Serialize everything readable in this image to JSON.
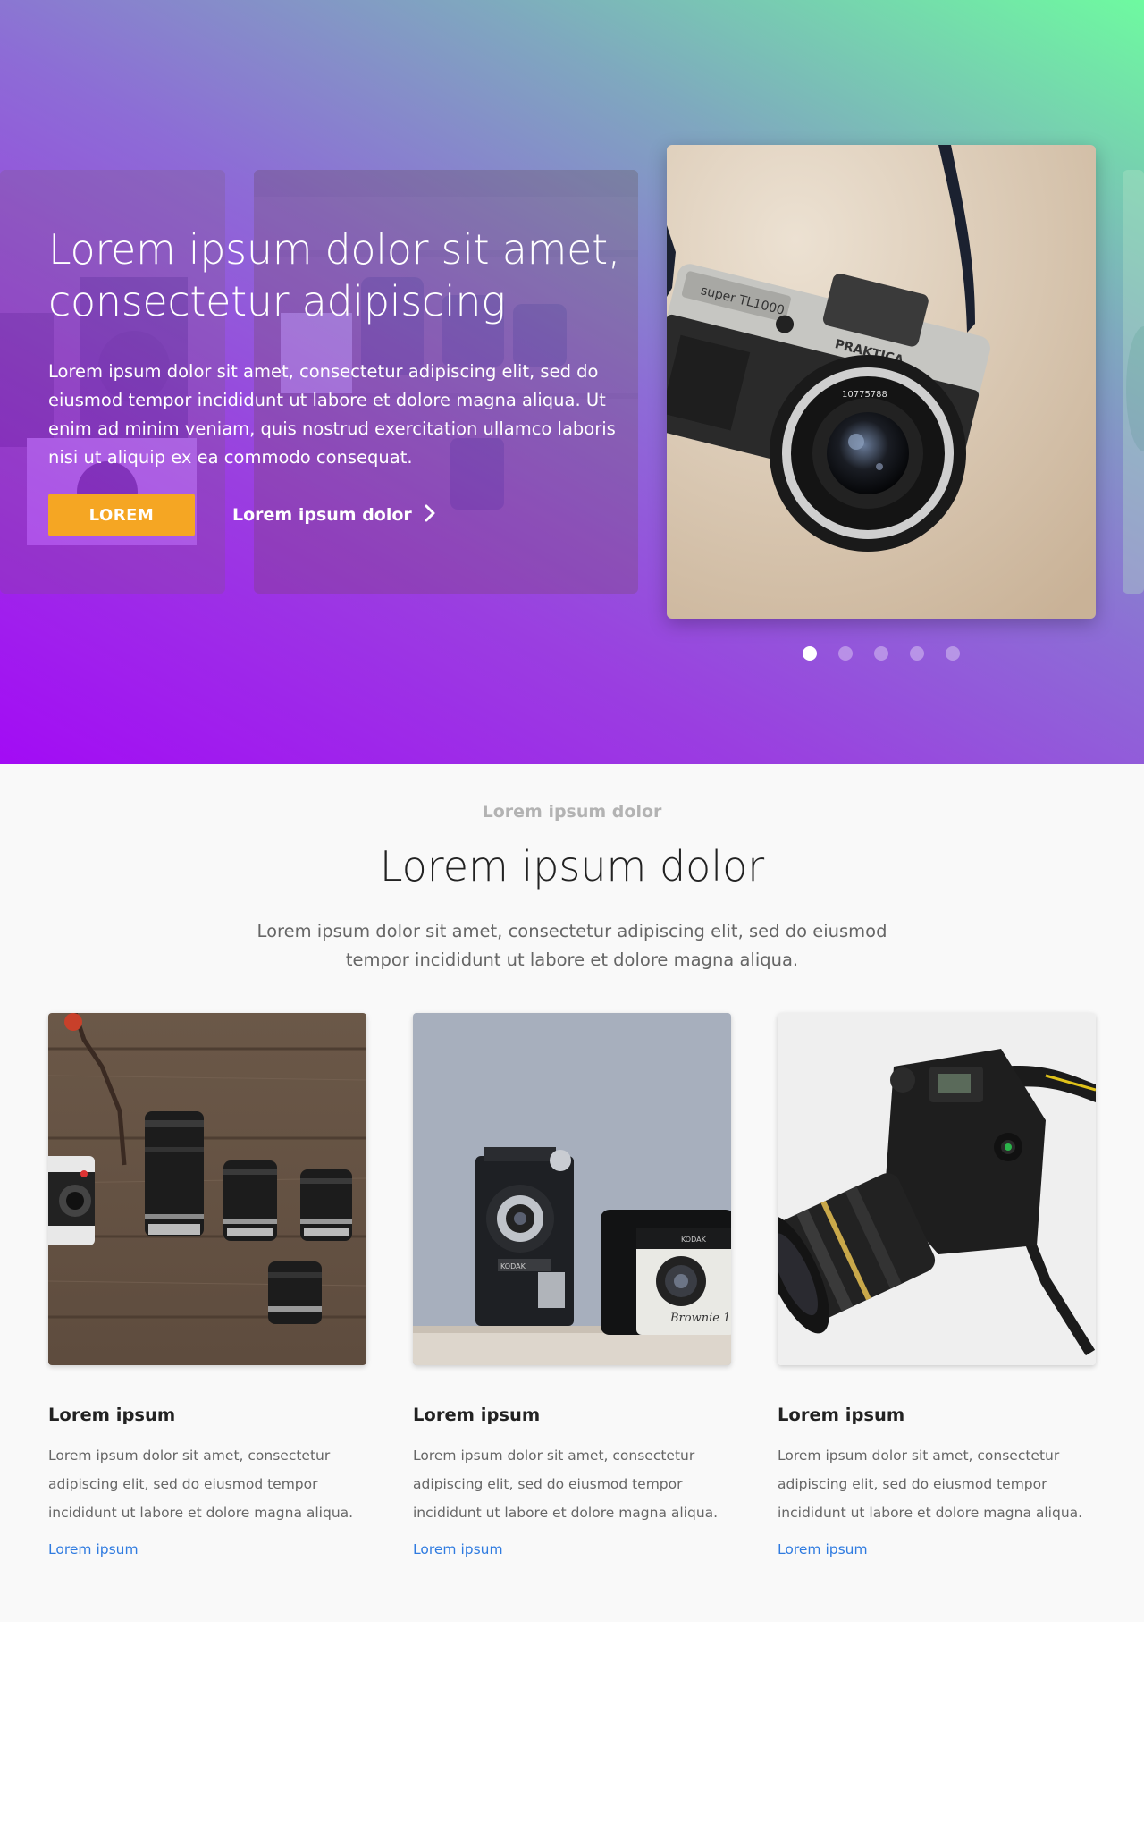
{
  "hero": {
    "title_line1": "Lorem ipsum dolor sit amet,",
    "title_line2": "consectetur adipiscing",
    "body": "Lorem ipsum dolor sit amet, consectetur adipiscing elit, sed do eiusmod tempor incididunt ut labore et dolore magna aliqua. Ut enim ad minim veniam, quis nostrud exercitation ullamco laboris nisi ut aliquip ex ea commodo consequat.",
    "primary_button": "LOREM",
    "secondary_link": "Lorem ipsum dolor",
    "photo_icon": "camera-photo",
    "carousel": {
      "total_slides": 5,
      "active_index": 0
    }
  },
  "features": {
    "eyebrow": "Lorem ipsum dolor",
    "title": "Lorem ipsum dolor",
    "description": "Lorem ipsum dolor sit amet, consectetur adipiscing elit, sed do eiusmod tempor incididunt ut labore et dolore magna aliqua.",
    "cards": [
      {
        "image": "lenses-on-wood-photo",
        "title": "Lorem ipsum",
        "body": "Lorem ipsum dolor sit amet, consectetur adipiscing elit, sed do eiusmod tempor incididunt ut labore et dolore magna aliqua.",
        "link": "Lorem ipsum"
      },
      {
        "image": "vintage-cameras-photo",
        "title": "Lorem ipsum",
        "body": "Lorem ipsum dolor sit amet, consectetur adipiscing elit, sed do eiusmod tempor incididunt ut labore et dolore magna aliqua.",
        "link": "Lorem ipsum"
      },
      {
        "image": "dslr-camera-photo",
        "title": "Lorem ipsum",
        "body": "Lorem ipsum dolor sit amet, consectetur adipiscing elit, sed do eiusmod tempor incididunt ut labore et dolore magna aliqua.",
        "link": "Lorem ipsum"
      }
    ]
  },
  "colors": {
    "gradient_start": "#a30bf5",
    "gradient_end": "#6efaa0",
    "button": "#f5a623",
    "link": "#2f7be0",
    "section_bg": "#f9f9f9"
  }
}
